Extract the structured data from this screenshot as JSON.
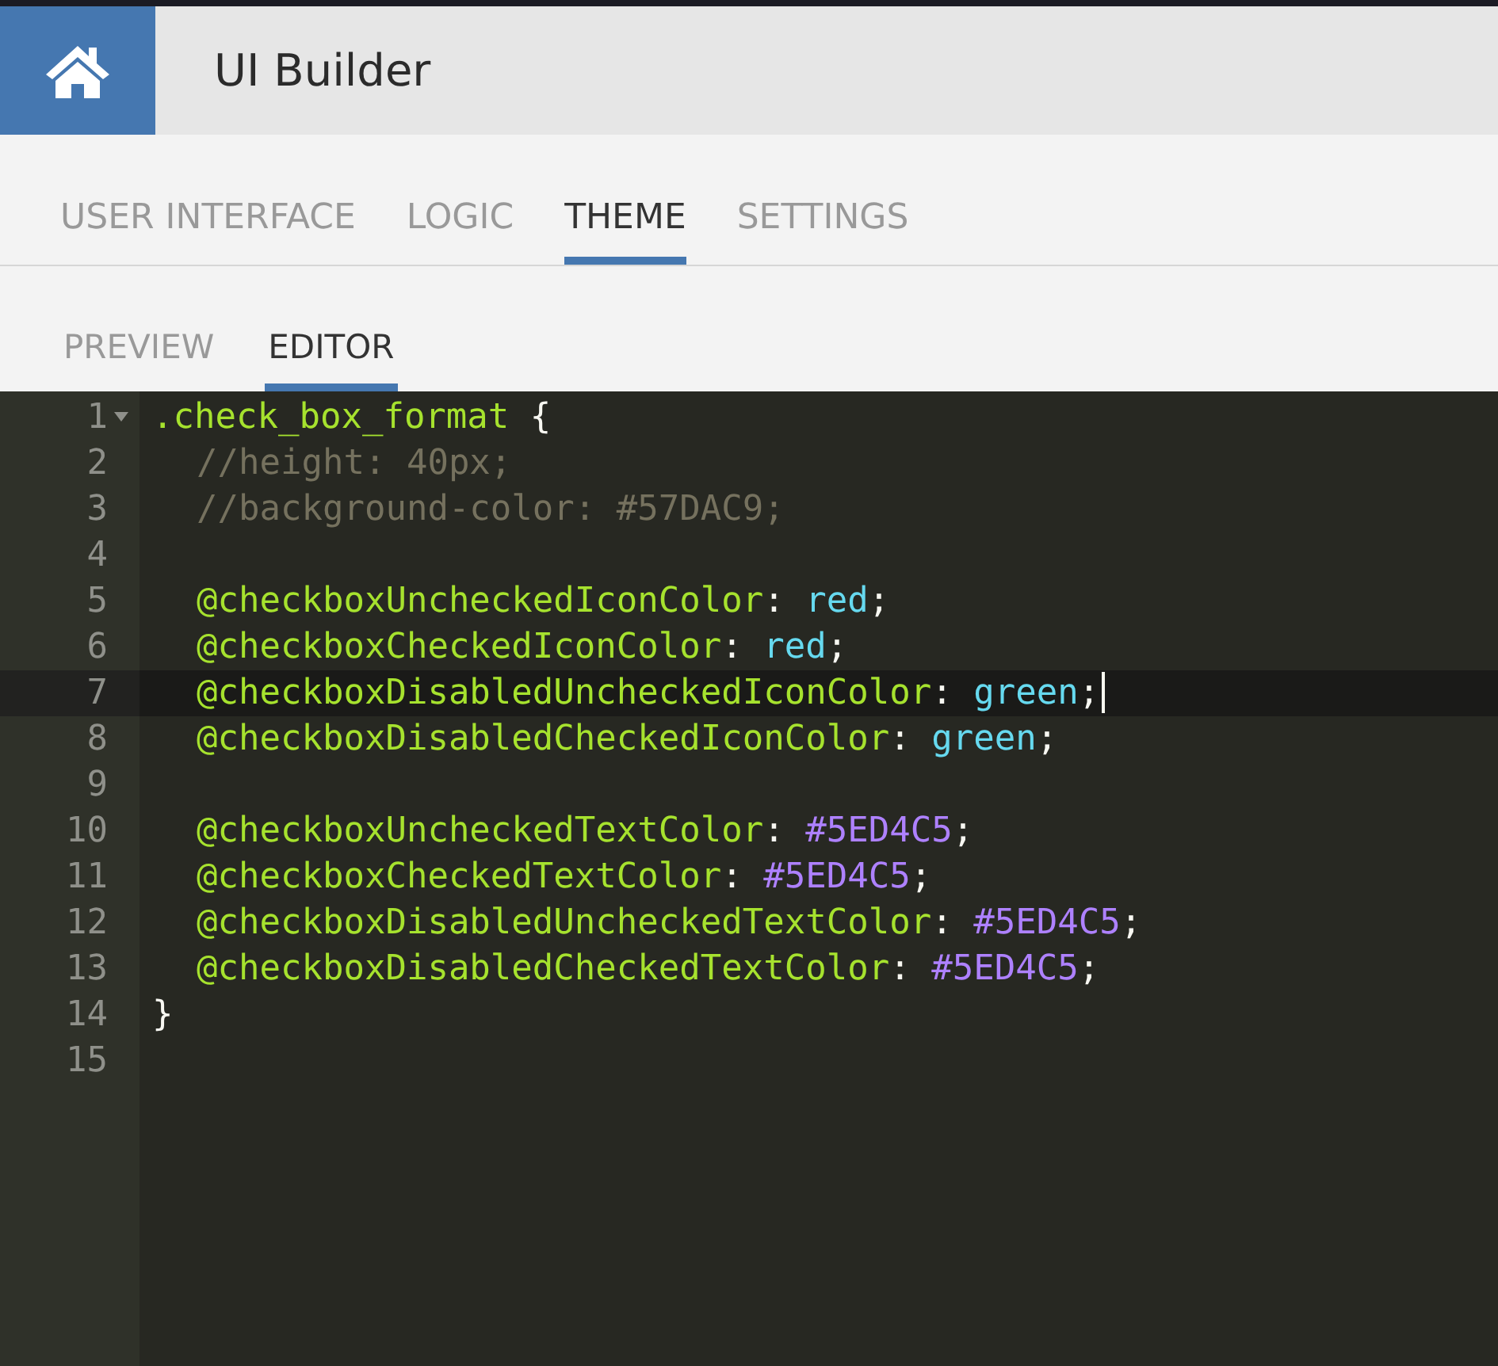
{
  "header": {
    "title": "UI Builder"
  },
  "tabs": [
    {
      "label": "USER INTERFACE",
      "selected": false
    },
    {
      "label": "LOGIC",
      "selected": false
    },
    {
      "label": "THEME",
      "selected": true
    },
    {
      "label": "SETTINGS",
      "selected": false
    }
  ],
  "subtabs": [
    {
      "label": "PREVIEW",
      "selected": false
    },
    {
      "label": "EDITOR",
      "selected": true
    }
  ],
  "editor": {
    "lines": [
      {
        "number": "1",
        "foldable": true,
        "active": false,
        "cursor": false,
        "indented": false,
        "tokens": [
          {
            "kind": "selector",
            "text": ".check_box_format"
          },
          {
            "kind": "punct",
            "text": " {"
          }
        ]
      },
      {
        "number": "2",
        "foldable": false,
        "active": false,
        "cursor": false,
        "indented": true,
        "tokens": [
          {
            "kind": "comment",
            "text": "//height: 40px;"
          }
        ]
      },
      {
        "number": "3",
        "foldable": false,
        "active": false,
        "cursor": false,
        "indented": true,
        "tokens": [
          {
            "kind": "comment",
            "text": "//background-color: #57DAC9;"
          }
        ]
      },
      {
        "number": "4",
        "foldable": false,
        "active": false,
        "cursor": false,
        "indented": false
      },
      {
        "number": "5",
        "foldable": false,
        "active": false,
        "cursor": false,
        "indented": true,
        "tokens": [
          {
            "kind": "variable",
            "text": "@checkboxUncheckedIconColor"
          },
          {
            "kind": "punct",
            "text": ": "
          },
          {
            "kind": "keyword",
            "text": "red"
          },
          {
            "kind": "punct",
            "text": ";"
          }
        ]
      },
      {
        "number": "6",
        "foldable": false,
        "active": false,
        "cursor": false,
        "indented": true,
        "tokens": [
          {
            "kind": "variable",
            "text": "@checkboxCheckedIconColor"
          },
          {
            "kind": "punct",
            "text": ": "
          },
          {
            "kind": "keyword",
            "text": "red"
          },
          {
            "kind": "punct",
            "text": ";"
          }
        ]
      },
      {
        "number": "7",
        "foldable": false,
        "active": true,
        "cursor": true,
        "indented": true,
        "tokens": [
          {
            "kind": "variable",
            "text": "@checkboxDisabledUncheckedIconColor"
          },
          {
            "kind": "punct",
            "text": ": "
          },
          {
            "kind": "keyword",
            "text": "green"
          },
          {
            "kind": "punct",
            "text": ";"
          }
        ]
      },
      {
        "number": "8",
        "foldable": false,
        "active": false,
        "cursor": false,
        "indented": true,
        "tokens": [
          {
            "kind": "variable",
            "text": "@checkboxDisabledCheckedIconColor"
          },
          {
            "kind": "punct",
            "text": ": "
          },
          {
            "kind": "keyword",
            "text": "green"
          },
          {
            "kind": "punct",
            "text": ";"
          }
        ]
      },
      {
        "number": "9",
        "foldable": false,
        "active": false,
        "cursor": false,
        "indented": false
      },
      {
        "number": "10",
        "foldable": false,
        "active": false,
        "cursor": false,
        "indented": true,
        "tokens": [
          {
            "kind": "variable",
            "text": "@checkboxUncheckedTextColor"
          },
          {
            "kind": "punct",
            "text": ": "
          },
          {
            "kind": "number",
            "text": "#5ED4C5"
          },
          {
            "kind": "punct",
            "text": ";"
          }
        ]
      },
      {
        "number": "11",
        "foldable": false,
        "active": false,
        "cursor": false,
        "indented": true,
        "tokens": [
          {
            "kind": "variable",
            "text": "@checkboxCheckedTextColor"
          },
          {
            "kind": "punct",
            "text": ": "
          },
          {
            "kind": "number",
            "text": "#5ED4C5"
          },
          {
            "kind": "punct",
            "text": ";"
          }
        ]
      },
      {
        "number": "12",
        "foldable": false,
        "active": false,
        "cursor": false,
        "indented": true,
        "tokens": [
          {
            "kind": "variable",
            "text": "@checkboxDisabledUncheckedTextColor"
          },
          {
            "kind": "punct",
            "text": ": "
          },
          {
            "kind": "number",
            "text": "#5ED4C5"
          },
          {
            "kind": "punct",
            "text": ";"
          }
        ]
      },
      {
        "number": "13",
        "foldable": false,
        "active": false,
        "cursor": false,
        "indented": true,
        "tokens": [
          {
            "kind": "variable",
            "text": "@checkboxDisabledCheckedTextColor"
          },
          {
            "kind": "punct",
            "text": ": "
          },
          {
            "kind": "number",
            "text": "#5ED4C5"
          },
          {
            "kind": "punct",
            "text": ";"
          }
        ]
      },
      {
        "number": "14",
        "foldable": false,
        "active": false,
        "cursor": false,
        "indented": false,
        "tokens": [
          {
            "kind": "punct",
            "text": "}"
          }
        ]
      },
      {
        "number": "15",
        "foldable": false,
        "active": false,
        "cursor": false,
        "indented": false
      }
    ]
  }
}
